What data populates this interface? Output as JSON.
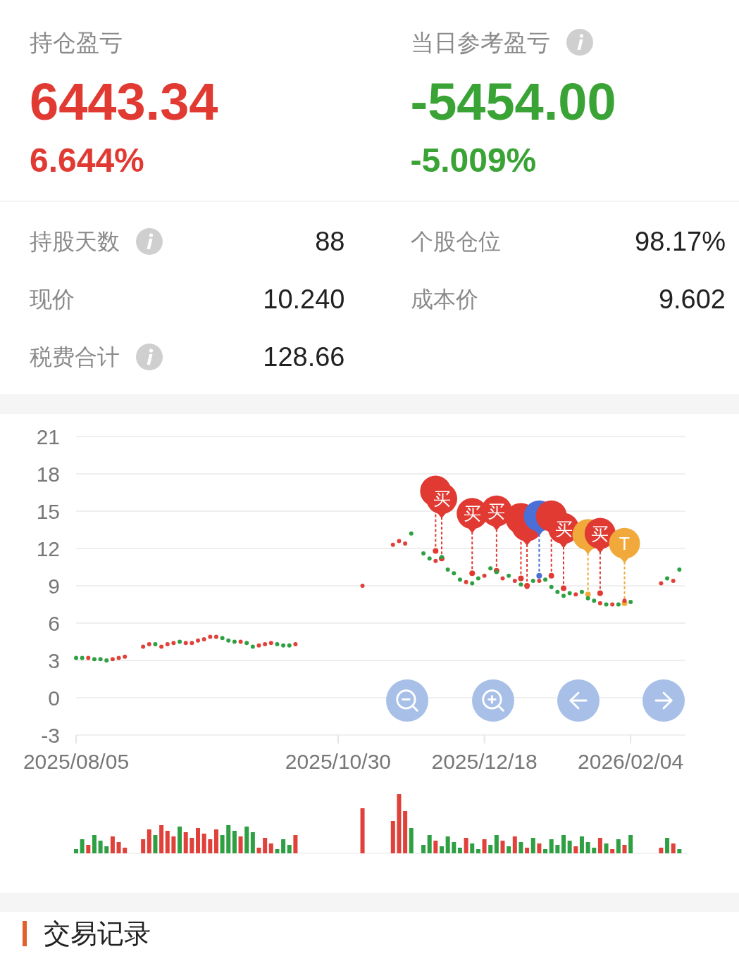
{
  "position_pnl": {
    "label": "持仓盈亏",
    "amount": "6443.34",
    "percent": "6.644%",
    "kind": "gain",
    "info": false
  },
  "daily_pnl": {
    "label": "当日参考盈亏",
    "amount": "-5454.00",
    "percent": "-5.009%",
    "kind": "loss",
    "info": true
  },
  "stats": [
    {
      "label": "持股天数",
      "value": "88",
      "info": true
    },
    {
      "label": "个股仓位",
      "value": "98.17%",
      "info": false
    },
    {
      "label": "现价",
      "value": "10.240",
      "info": false
    },
    {
      "label": "成本价",
      "value": "9.602",
      "info": false
    },
    {
      "label": "税费合计",
      "value": "128.66",
      "info": true
    }
  ],
  "chart": {
    "chart_data": {
      "type": "scatter",
      "categories": [
        "2025/08/05",
        null,
        null,
        null,
        null,
        null,
        null,
        null,
        null,
        null,
        null,
        null,
        null,
        null,
        null,
        null,
        null,
        null,
        null,
        null,
        null,
        null,
        null,
        null,
        null,
        null,
        null,
        null,
        null,
        null,
        null,
        null,
        null,
        null,
        null,
        null,
        null,
        null,
        null,
        null,
        null,
        null,
        null,
        "2025/10/30",
        null,
        null,
        null,
        null,
        null,
        null,
        null,
        null,
        null,
        null,
        null,
        null,
        null,
        null,
        null,
        null,
        null,
        null,
        null,
        null,
        null,
        null,
        null,
        "2025/12/18",
        null,
        null,
        null,
        null,
        null,
        null,
        null,
        null,
        null,
        null,
        null,
        null,
        null,
        null,
        null,
        null,
        null,
        null,
        null,
        null,
        null,
        null,
        null,
        "2026/02/04",
        null,
        null,
        null,
        null,
        null,
        null,
        null,
        null,
        null
      ],
      "series": [
        {
          "color": "#e0413a",
          "values": [
            null,
            null,
            3.2,
            null,
            null,
            null,
            3.1,
            3.2,
            3.3,
            null,
            null,
            4.1,
            4.3,
            null,
            4.1,
            4.3,
            4.4,
            null,
            4.4,
            4.4,
            4.6,
            4.7,
            4.9,
            4.9,
            null,
            null,
            null,
            4.5,
            null,
            null,
            4.2,
            4.3,
            4.4,
            null,
            null,
            null,
            4.3,
            null,
            null,
            null,
            null,
            null,
            null,
            null,
            null,
            null,
            null,
            9.0,
            null,
            null,
            null,
            null,
            12.3,
            12.6,
            12.4,
            null,
            null,
            null,
            null,
            11.0,
            null,
            null,
            null,
            null,
            9.3,
            null,
            null,
            9.8,
            null,
            null,
            9.6,
            null,
            9.4,
            null,
            8.9,
            null,
            9.4,
            null,
            null,
            null,
            null,
            null,
            8.3,
            null,
            null,
            null,
            7.6,
            null,
            7.5,
            null,
            7.8,
            null,
            null,
            null,
            null,
            null,
            9.2,
            null,
            9.4,
            null,
            null
          ]
        },
        {
          "color": "#2ea043",
          "values": [
            3.2,
            3.2,
            null,
            3.1,
            3.1,
            3.0,
            null,
            null,
            null,
            null,
            null,
            null,
            null,
            4.3,
            null,
            null,
            null,
            4.5,
            null,
            null,
            null,
            null,
            null,
            null,
            4.8,
            4.6,
            4.5,
            null,
            4.4,
            4.1,
            null,
            null,
            null,
            4.3,
            4.2,
            4.2,
            null,
            null,
            null,
            null,
            null,
            null,
            null,
            null,
            null,
            null,
            null,
            null,
            null,
            null,
            null,
            null,
            null,
            null,
            null,
            13.2,
            null,
            11.6,
            11.2,
            null,
            11.3,
            10.3,
            10.0,
            9.5,
            null,
            9.2,
            9.6,
            null,
            10.4,
            10.1,
            null,
            9.8,
            null,
            9.1,
            null,
            9.4,
            null,
            9.5,
            8.9,
            8.5,
            8.2,
            8.4,
            null,
            8.5,
            8.0,
            7.8,
            null,
            7.5,
            null,
            7.5,
            null,
            7.7,
            null,
            null,
            null,
            null,
            null,
            9.6,
            null,
            10.3,
            null
          ]
        }
      ],
      "ylim": [
        -3,
        21
      ],
      "grid": true,
      "yticks": [
        -3,
        0,
        3,
        6,
        9,
        12,
        15,
        18,
        21
      ]
    },
    "markers": [
      {
        "color": "#e03a32"
      },
      {
        "color": "#e03a32",
        "label": "买"
      },
      {
        "color": "#e03a32",
        "label": "买"
      },
      {
        "color": "#e03a32",
        "label": "买"
      },
      {
        "color": "#e03a32"
      },
      {
        "color": "#e03a32"
      },
      {
        "color": "#4a6fd6"
      },
      {
        "color": "#e03a32"
      },
      {
        "color": "#e03a32",
        "label": "买"
      },
      {
        "color": "#f0a93a"
      },
      {
        "color": "#e03a32",
        "label": "买"
      },
      {
        "color": "#f0a93a",
        "label": "T"
      }
    ],
    "controls": [
      {
        "kind": "zoom_out"
      },
      {
        "kind": "zoom_in"
      },
      {
        "kind": "previous"
      },
      {
        "kind": "next"
      }
    ]
  },
  "section_title": "交易记录"
}
